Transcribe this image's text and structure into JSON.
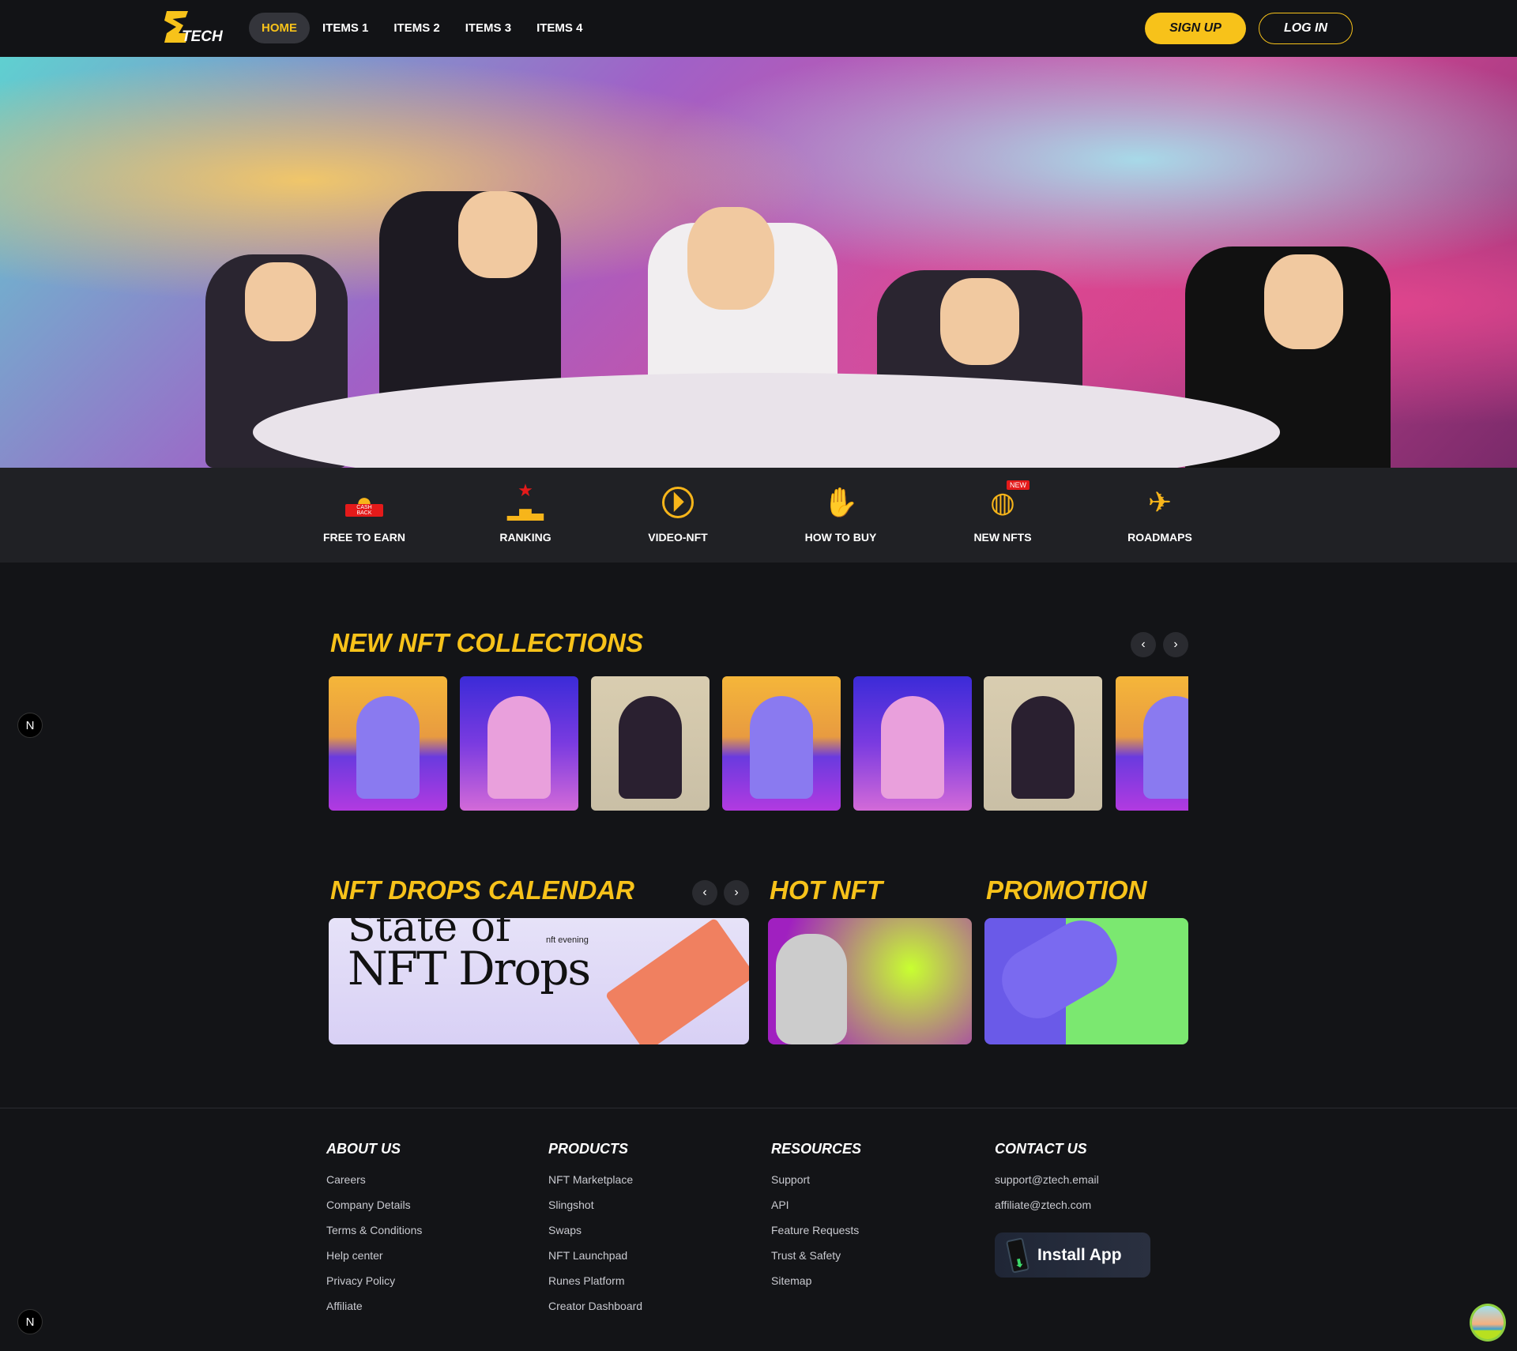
{
  "header": {
    "logo": "ZTECH",
    "logo_text": "TECH",
    "nav": [
      "HOME",
      "ITEMS 1",
      "ITEMS 2",
      "ITEMS 3",
      "ITEMS 4"
    ],
    "signup": "SIGN UP",
    "login": "LOG IN"
  },
  "hero": {
    "slides": 3,
    "active_slide": 3
  },
  "quick_links": [
    {
      "label": "FREE TO EARN",
      "icon": "cashback-coin-icon",
      "badge_text": "CASH BACK"
    },
    {
      "label": "RANKING",
      "icon": "podium-icon"
    },
    {
      "label": "VIDEO-NFT",
      "icon": "play-circle-icon"
    },
    {
      "label": "HOW TO BUY",
      "icon": "hand-icon"
    },
    {
      "label": "NEW NFTS",
      "icon": "globe-icon",
      "badge": "NEW"
    },
    {
      "label": "ROADMAPS",
      "icon": "plane-icon"
    }
  ],
  "collections": {
    "title": "NEW NFT COLLECTIONS"
  },
  "drops": {
    "title": "NFT DROPS CALENDAR",
    "banner_line1": "State of",
    "banner_line2": "NFT Drops",
    "brand": "nft evening"
  },
  "hot": {
    "title": "HOT NFT"
  },
  "promotion": {
    "title": "PROMOTION"
  },
  "footer": {
    "about": {
      "title": "ABOUT US",
      "links": [
        "Careers",
        "Company Details",
        "Terms & Conditions",
        "Help center",
        "Privacy Policy",
        "Affiliate"
      ]
    },
    "products": {
      "title": "PRODUCTS",
      "links": [
        "NFT Marketplace",
        "Slingshot",
        "Swaps",
        "NFT Launchpad",
        "Runes Platform",
        "Creator Dashboard"
      ]
    },
    "resources": {
      "title": "RESOURCES",
      "links": [
        "Support",
        "API",
        "Feature Requests",
        "Trust & Safety",
        "Sitemap"
      ]
    },
    "contact": {
      "title": "CONTACT US",
      "links": [
        "support@ztech.email",
        "affiliate@ztech.com"
      ]
    },
    "install": "Install App"
  },
  "floating": {
    "n_label": "N"
  },
  "colors": {
    "accent": "#f7c21a",
    "bg": "#131417",
    "strip": "#202125"
  }
}
